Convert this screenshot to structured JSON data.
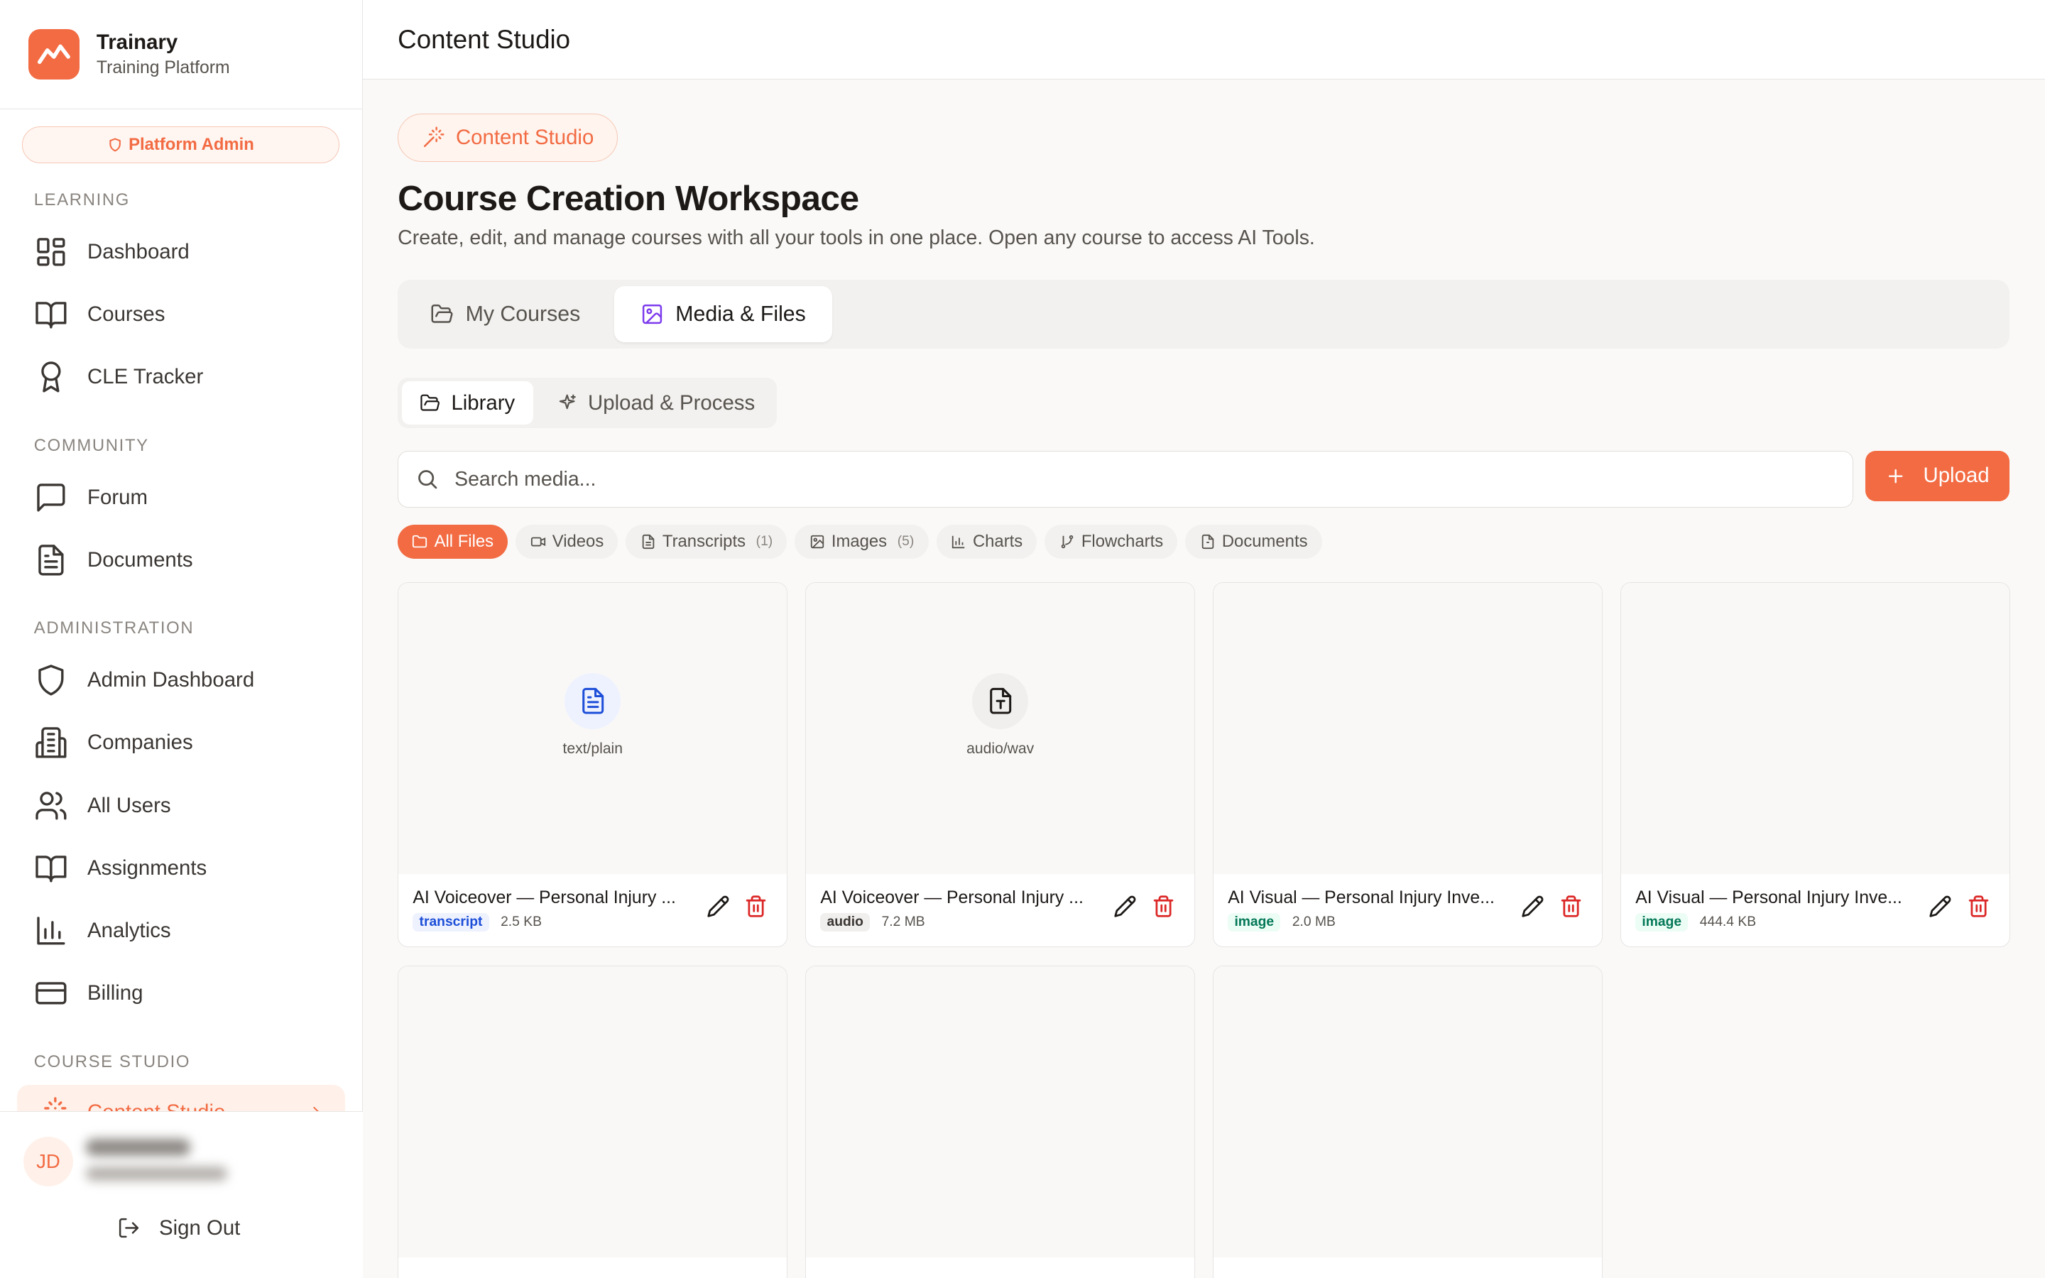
{
  "brand": {
    "name": "Trainary",
    "subtitle": "Training Platform",
    "accent": "#f26b43"
  },
  "sidebar": {
    "admin_badge": "Platform Admin",
    "sections": [
      {
        "label": "LEARNING",
        "items": [
          {
            "label": "Dashboard",
            "icon": "dashboard-grid-icon"
          },
          {
            "label": "Courses",
            "icon": "book-icon"
          },
          {
            "label": "CLE Tracker",
            "icon": "award-icon"
          }
        ]
      },
      {
        "label": "COMMUNITY",
        "items": [
          {
            "label": "Forum",
            "icon": "message-icon"
          },
          {
            "label": "Documents",
            "icon": "file-icon"
          }
        ]
      },
      {
        "label": "ADMINISTRATION",
        "items": [
          {
            "label": "Admin Dashboard",
            "icon": "shield-icon"
          },
          {
            "label": "Companies",
            "icon": "building-icon"
          },
          {
            "label": "All Users",
            "icon": "users-icon"
          },
          {
            "label": "Assignments",
            "icon": "book-open-icon"
          },
          {
            "label": "Analytics",
            "icon": "bar-chart-icon"
          },
          {
            "label": "Billing",
            "icon": "credit-card-icon"
          }
        ]
      },
      {
        "label": "COURSE STUDIO",
        "items": [
          {
            "label": "Content Studio",
            "icon": "wand-icon",
            "active": true
          }
        ]
      }
    ],
    "user": {
      "initials": "JD"
    },
    "sign_out": "Sign Out"
  },
  "header": {
    "title": "Content Studio"
  },
  "page": {
    "badge": "Content Studio",
    "title": "Course Creation Workspace",
    "subtitle": "Create, edit, and manage courses with all your tools in one place. Open any course to access AI Tools.",
    "tabs": [
      {
        "label": "My Courses",
        "active": false
      },
      {
        "label": "Media & Files",
        "active": true
      }
    ],
    "subtabs": [
      {
        "label": "Library",
        "active": true
      },
      {
        "label": "Upload & Process",
        "active": false
      }
    ],
    "search": {
      "placeholder": "Search media...",
      "value": ""
    },
    "upload_label": "Upload",
    "filters": [
      {
        "label": "All Files",
        "count": "",
        "active": true
      },
      {
        "label": "Videos",
        "count": ""
      },
      {
        "label": "Transcripts",
        "count": "(1)"
      },
      {
        "label": "Images",
        "count": "(5)"
      },
      {
        "label": "Charts",
        "count": ""
      },
      {
        "label": "Flowcharts",
        "count": ""
      },
      {
        "label": "Documents",
        "count": ""
      }
    ],
    "media": [
      {
        "name": "AI Voiceover — Personal Injury ...",
        "type": "transcript",
        "size": "2.5 KB",
        "mime": "text/plain"
      },
      {
        "name": "AI Voiceover — Personal Injury ...",
        "type": "audio",
        "size": "7.2 MB",
        "mime": "audio/wav"
      },
      {
        "name": "AI Visual — Personal Injury Inve...",
        "type": "image",
        "size": "2.0 MB",
        "mime": ""
      },
      {
        "name": "AI Visual — Personal Injury Inve...",
        "type": "image",
        "size": "444.4 KB",
        "mime": ""
      },
      {
        "name": "",
        "type": "",
        "size": "",
        "mime": ""
      },
      {
        "name": "",
        "type": "",
        "size": "",
        "mime": ""
      },
      {
        "name": "",
        "type": "",
        "size": "",
        "mime": ""
      }
    ]
  }
}
